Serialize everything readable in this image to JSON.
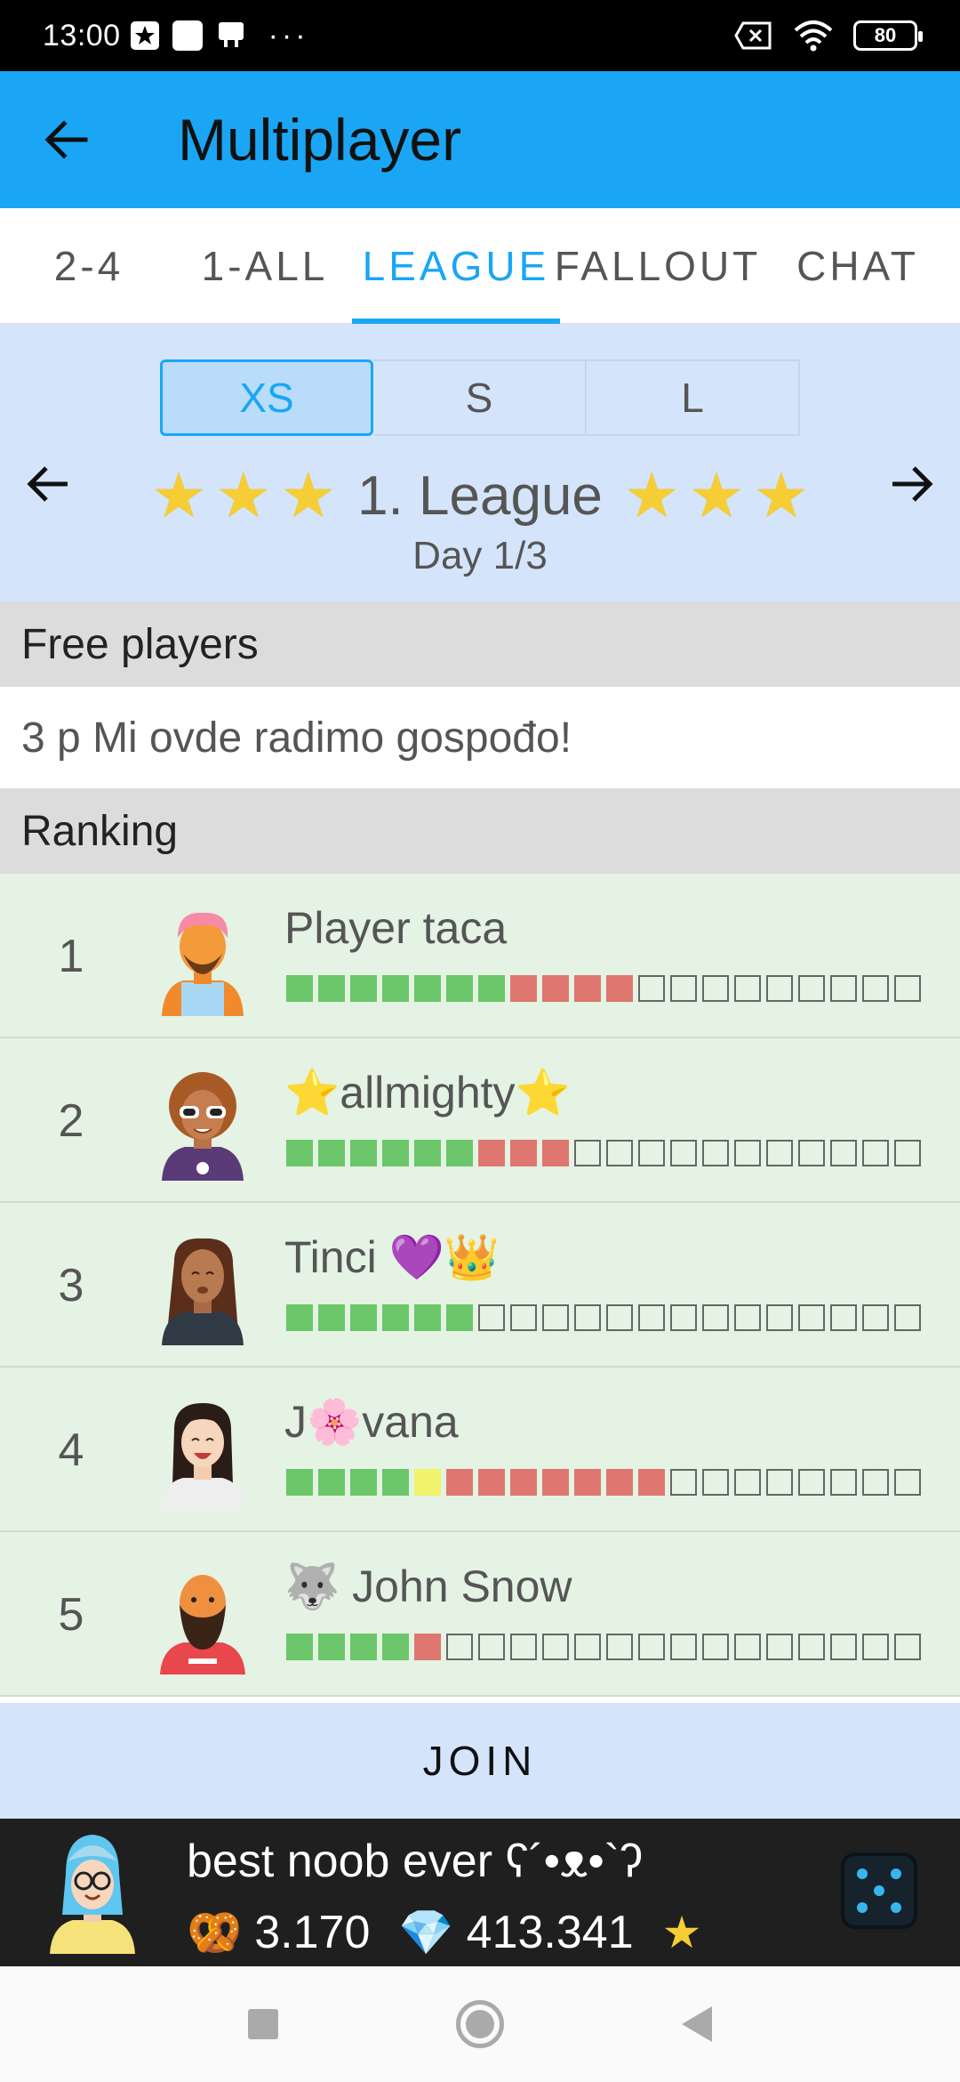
{
  "status_bar": {
    "time": "13:00",
    "battery": "80",
    "icons": [
      "star-notification-icon",
      "square-notification-icon",
      "game-notification-icon",
      "more-dots-icon",
      "sim-off-icon",
      "wifi-icon",
      "battery-icon"
    ]
  },
  "app_bar": {
    "title": "Multiplayer",
    "back_icon": "arrow-left-icon",
    "color": "#1aa6f5"
  },
  "tabs": [
    {
      "label": "2-4",
      "active": false
    },
    {
      "label": "1-ALL",
      "active": false
    },
    {
      "label": "LEAGUE",
      "active": true
    },
    {
      "label": "FALLOUT",
      "active": false
    },
    {
      "label": "CHAT",
      "active": false
    }
  ],
  "league": {
    "sizes": [
      "XS",
      "S",
      "L"
    ],
    "selected_size": "XS",
    "title": "1. League",
    "stars_each_side": 3,
    "day": "Day 1/3"
  },
  "free_players": {
    "header": "Free players",
    "text": "3 p Mi ovde radimo gospođo!"
  },
  "ranking": {
    "header": "Ranking",
    "rows": [
      {
        "rank": "1",
        "name": "Player taca",
        "progress": "gggggggrrrreeeeeeeee"
      },
      {
        "rank": "2",
        "name": "⭐allmighty⭐",
        "progress": "ggggggrrreeeeeeeeeee"
      },
      {
        "rank": "3",
        "name": "Tinci 💜👑",
        "progress": "ggggggeeeeeeeeeeeeee"
      },
      {
        "rank": "4",
        "name": "J🌸vana",
        "progress": "ggggyrrrrrrreeeeeeee"
      },
      {
        "rank": "5",
        "name": "🐺 John Snow",
        "progress": "ggggreeeeeeeeeeeeeee"
      }
    ]
  },
  "join_label": "JOIN",
  "player_bar": {
    "name": "best noob ever ʕ´•ᴥ•`ʔ",
    "pretzels": "3.170",
    "gems": "413.341",
    "icons": [
      "pretzel-icon",
      "diamond-icon",
      "star-icon",
      "dice-icon"
    ]
  },
  "colors": {
    "accent": "#1aa6f5",
    "progress_win": "#6bc76a",
    "progress_loss": "#df7670",
    "progress_draw": "#f1f36a",
    "row_bg": "#e4f3e3",
    "league_bg": "#d4e5fb"
  }
}
